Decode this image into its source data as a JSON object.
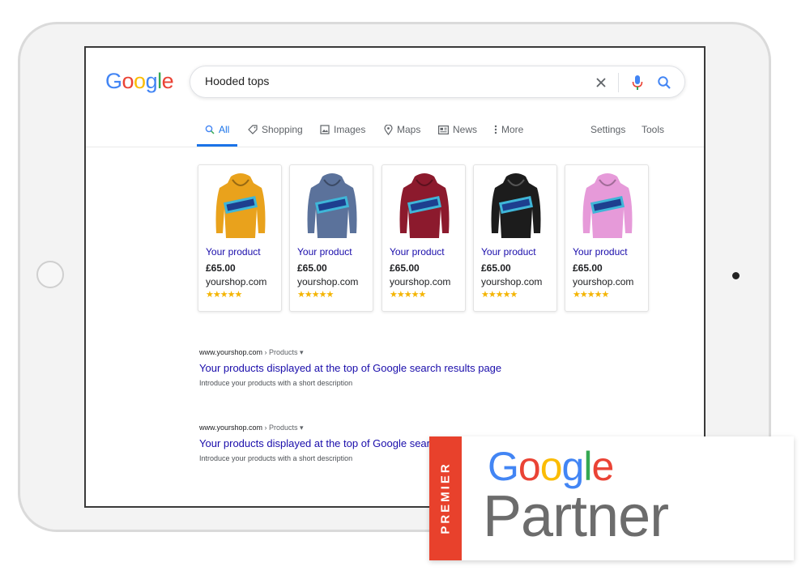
{
  "google_logo": [
    "G",
    "o",
    "o",
    "g",
    "l",
    "e"
  ],
  "search": {
    "query": "Hooded tops"
  },
  "icons": {
    "clear": "close-icon",
    "voice": "mic-icon",
    "search": "search-icon"
  },
  "tabs": [
    {
      "label": "All",
      "icon": "search-icon",
      "active": true
    },
    {
      "label": "Shopping",
      "icon": "tag-icon"
    },
    {
      "label": "Images",
      "icon": "image-icon"
    },
    {
      "label": "Maps",
      "icon": "location-pin-icon"
    },
    {
      "label": "News",
      "icon": "news-icon"
    },
    {
      "label": "More",
      "icon": "more-vert-icon"
    }
  ],
  "tools": {
    "settings": "Settings",
    "tools": "Tools"
  },
  "products": [
    {
      "name": "Your product",
      "price": "£65.00",
      "shop": "yourshop.com",
      "stars": "★★★★★",
      "color": "#e9a21c"
    },
    {
      "name": "Your product",
      "price": "£65.00",
      "shop": "yourshop.com",
      "stars": "★★★★★",
      "color": "#5b729b"
    },
    {
      "name": "Your product",
      "price": "£65.00",
      "shop": "yourshop.com",
      "stars": "★★★★★",
      "color": "#8c1a2d"
    },
    {
      "name": "Your product",
      "price": "£65.00",
      "shop": "yourshop.com",
      "stars": "★★★★★",
      "color": "#1c1c1c"
    },
    {
      "name": "Your product",
      "price": "£65.00",
      "shop": "yourshop.com",
      "stars": "★★★★★",
      "color": "#e69ad9"
    }
  ],
  "results": [
    {
      "domain": "www.yourshop.com",
      "crumb": "› Products ▾",
      "title": "Your products displayed at the top of Google search results page",
      "desc": "Introduce your products with a short description"
    },
    {
      "domain": "www.yourshop.com",
      "crumb": "› Products ▾",
      "title": "Your products displayed at the top of Google search results page",
      "desc": "Introduce your products with a short description"
    }
  ],
  "badge": {
    "ribbon": "PREMIER",
    "brand": [
      "G",
      "o",
      "o",
      "g",
      "l",
      "e"
    ],
    "partner": "Partner"
  },
  "colors": {
    "blue": "#4285f4",
    "red": "#ea4335",
    "yellow": "#fbbc05",
    "green": "#34a853",
    "link": "#1a0dab",
    "ribbon": "#e8412c"
  }
}
